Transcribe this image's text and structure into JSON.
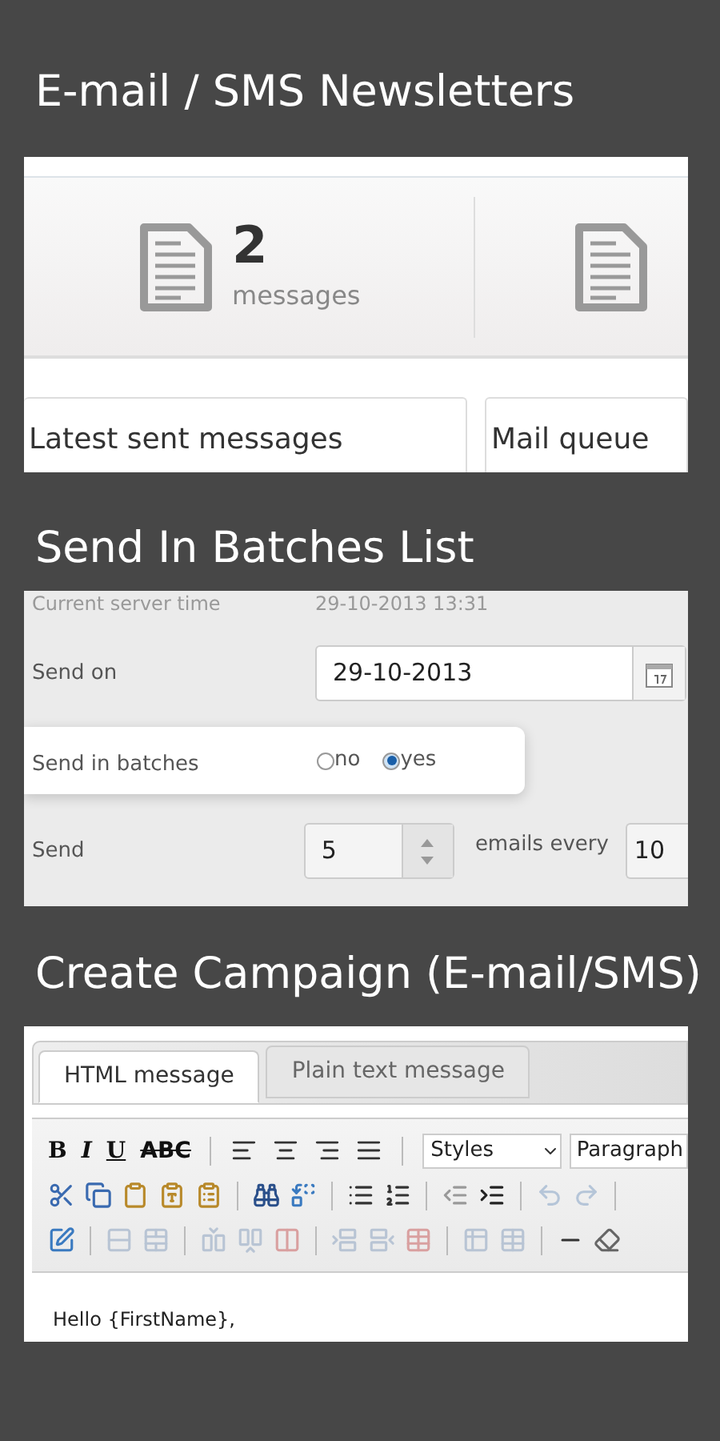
{
  "sections": [
    {
      "kind": "dashboard",
      "title": "E-mail / SMS Newsletters",
      "stats": [
        {
          "value": "2",
          "label": "messages"
        }
      ],
      "boxes": [
        "Latest sent messages",
        "Mail queue"
      ]
    },
    {
      "kind": "form",
      "title": "Send In Batches List",
      "server_time": {
        "label": "Current server time",
        "value": "29-10-2013 13:31"
      },
      "send_on": {
        "label": "Send on",
        "value": "29-10-2013"
      },
      "batches": {
        "label": "Send in batches",
        "options": [
          {
            "label": "no",
            "selected": false
          },
          {
            "label": "yes",
            "selected": true
          }
        ]
      },
      "send": {
        "label": "Send",
        "value": "5",
        "unit": "emails every",
        "value2": "10"
      }
    },
    {
      "kind": "editor",
      "title": "Create Campaign (E-mail/SMS)",
      "tabs": [
        {
          "label": "HTML message",
          "selected": true
        },
        {
          "label": "Plain text message",
          "selected": false
        }
      ],
      "format_buttons": [
        "B",
        "I",
        "U",
        "ABC"
      ],
      "style_select": "Styles",
      "format_select": "Paragraph",
      "body": "Hello {FirstName},"
    }
  ]
}
